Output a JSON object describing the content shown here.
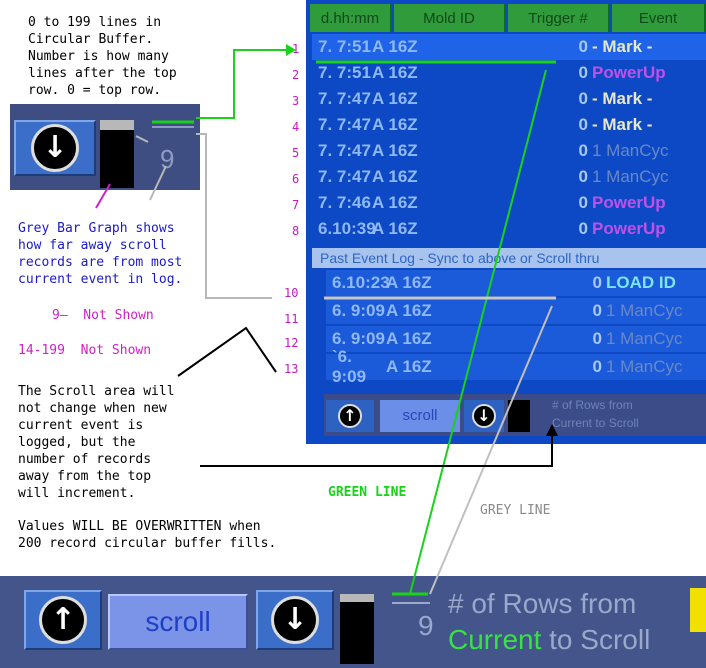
{
  "notes": {
    "buffer": "0 to 199 lines in\nCircular Buffer.\nNumber is how many\nlines after the top\nrow. 0 = top row.",
    "bar_graph": "Grey Bar Graph shows\nhow far away scroll\nrecords are from most\ncurrent event in log.",
    "nine_not_shown": "9—  Not Shown",
    "range_not_shown": "14-199  Not Shown",
    "scroll_area": "The Scroll area will\nnot change when new\ncurrent event is\nlogged, but the\nnumber of records\naway from the top\nwill increment.",
    "green_line": "GREEN LINE",
    "grey_line": "GREY LINE",
    "overwrite": "Values WILL BE OVERWRITTEN when\n200 record circular buffer fills."
  },
  "row_numbers": [
    "1",
    "2",
    "3",
    "4",
    "5",
    "6",
    "7",
    "8",
    "10",
    "11",
    "12",
    "13"
  ],
  "mini_widget": {
    "count": "9",
    "down_icon": "down-arrow-icon",
    "bar_fraction": 0.15
  },
  "screen": {
    "headers": [
      "d.hh:mm",
      "Mold ID",
      "Trigger #",
      "Event"
    ],
    "top_rows": [
      {
        "time": "7. 7:51",
        "mold": "A 16Z",
        "trigger": "0",
        "event": "- Mark -",
        "kind": "mark"
      },
      {
        "time": "7. 7:51",
        "mold": "A 16Z",
        "trigger": "0",
        "event": "PowerUp",
        "kind": "power"
      },
      {
        "time": "7. 7:47",
        "mold": "A 16Z",
        "trigger": "0",
        "event": "- Mark -",
        "kind": "mark"
      },
      {
        "time": "7. 7:47",
        "mold": "A 16Z",
        "trigger": "0",
        "event": "- Mark -",
        "kind": "mark"
      },
      {
        "time": "7. 7:47",
        "mold": "A 16Z",
        "trigger": "0",
        "event": "1 ManCyc",
        "kind": "cyc"
      },
      {
        "time": "7. 7:47",
        "mold": "A 16Z",
        "trigger": "0",
        "event": "1 ManCyc",
        "kind": "cyc"
      },
      {
        "time": "7. 7:46",
        "mold": "A 16Z",
        "trigger": "0",
        "event": "PowerUp",
        "kind": "power"
      },
      {
        "time": "6.10:39",
        "mold": "A 16Z",
        "trigger": "0",
        "event": "PowerUp",
        "kind": "power"
      }
    ],
    "banner": "Past Event Log - Sync to above or Scroll thru",
    "lower_rows": [
      {
        "time": "6.10:23",
        "mold": "A 16Z",
        "trigger": "0",
        "event": "LOAD ID",
        "kind": "load"
      },
      {
        "time": "6. 9:09",
        "mold": "A 16Z",
        "trigger": "0",
        "event": "1 ManCyc",
        "kind": "cyc"
      },
      {
        "time": "6. 9:09",
        "mold": "A 16Z",
        "trigger": "0",
        "event": "1 ManCyc",
        "kind": "cyc"
      },
      {
        "time": "`6. 9:09",
        "mold": "A 16Z",
        "trigger": "0",
        "event": "1 ManCyc",
        "kind": "cyc"
      }
    ],
    "footer": {
      "scroll": "scroll",
      "label": "# of Rows from\nCurrent to Scroll"
    }
  },
  "bottom_bar": {
    "scroll_label": "scroll",
    "count": "9",
    "label_line1": "# of Rows from",
    "label_current": "Current",
    "label_rest": " to Scroll",
    "bar_fraction": 0.12
  },
  "colors": {
    "green_line": "#19d219",
    "grey_line": "#b8b8b8",
    "black_line": "#000000",
    "magenta": "#d020c8"
  }
}
